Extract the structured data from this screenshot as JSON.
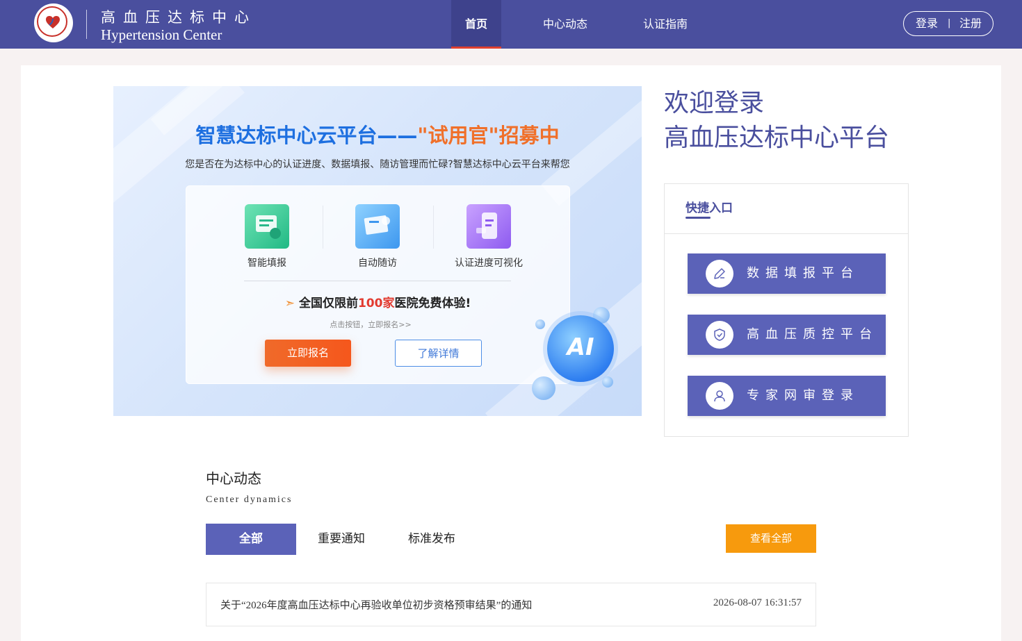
{
  "header": {
    "brand_cn": "高血压达标中心",
    "brand_en": "Hypertension Center",
    "nav": [
      {
        "label": "首页",
        "active": true
      },
      {
        "label": "中心动态",
        "active": false
      },
      {
        "label": "认证指南",
        "active": false
      }
    ],
    "login_label": "登录",
    "separator": "|",
    "register_label": "注册"
  },
  "banner": {
    "title_part1": "智慧达标中心云平台——",
    "title_part2": "\"试用官\"招募中",
    "subtitle": "您是否在为达标中心的认证进度、数据填报、随访管理而忙碌?智慧达标中心云平台来帮您",
    "features": [
      {
        "label": "智能填报",
        "icon": "form-icon"
      },
      {
        "label": "自动随访",
        "icon": "followup-icon"
      },
      {
        "label": "认证进度可视化",
        "icon": "progress-icon"
      }
    ],
    "promo_prefix": "全国仅限前",
    "promo_highlight": "100家",
    "promo_suffix": "医院免费体验!",
    "hint": "点击按钮，立即报名>>",
    "signup_label": "立即报名",
    "details_label": "了解详情",
    "ai_badge": "AI"
  },
  "welcome": {
    "line1": "欢迎登录",
    "line2": "高血压达标中心平台"
  },
  "quick_access": {
    "title": "快捷入口",
    "buttons": [
      {
        "label": "数据填报平台",
        "icon": "pencil-icon"
      },
      {
        "label": "高血压质控平台",
        "icon": "shield-check-icon"
      },
      {
        "label": "专家网审登录",
        "icon": "user-icon"
      }
    ]
  },
  "dynamics": {
    "title": "中心动态",
    "subtitle": "Center dynamics",
    "tabs": [
      {
        "label": "全部",
        "active": true
      },
      {
        "label": "重要通知",
        "active": false
      },
      {
        "label": "标准发布",
        "active": false
      }
    ],
    "view_all_label": "查看全部",
    "news": [
      {
        "title": "关于“2026年度高血压达标中心再验收单位初步资格预审结果”的通知",
        "date": "2026-08-07 16:31:57"
      }
    ]
  },
  "colors": {
    "primary": "#4a4f9e",
    "button": "#5b62b8",
    "accent_orange": "#f79a0d",
    "accent_red": "#e0402f"
  }
}
